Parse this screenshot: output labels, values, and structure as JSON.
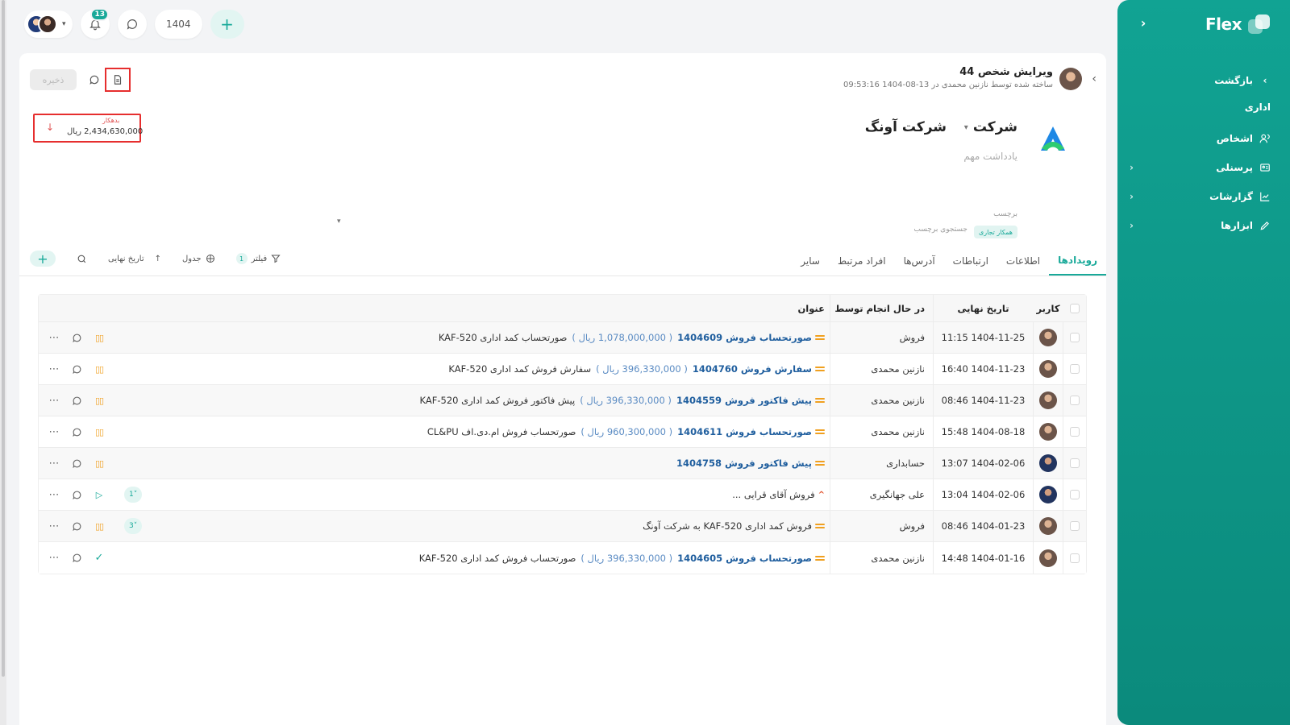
{
  "topbar": {
    "notification_count": "13",
    "year": "1404",
    "plus": "+"
  },
  "sidebar": {
    "logo": "Flex",
    "collapse": "‹",
    "back": "بازگشت",
    "section": "اداری",
    "items": [
      {
        "label": "اشخاص"
      },
      {
        "label": "پرسنلی"
      },
      {
        "label": "گزارشات"
      },
      {
        "label": "ابزارها"
      }
    ]
  },
  "header": {
    "title": "ویرایش شخص 44",
    "subtitle": "ساخته شده توسط نازنین محمدی در 13-08-1404 09:53:16",
    "save": "ذخیره"
  },
  "debt": {
    "label": "بدهکار",
    "amount": "2,434,630,000 ریال"
  },
  "company": {
    "type": "شرکت",
    "name": "شرکت آونگ",
    "note_placeholder": "یادداشت مهم"
  },
  "tags": {
    "label": "برچسب",
    "chip": "همکار تجاری",
    "search_placeholder": "جستجوی برچسب"
  },
  "tabs": [
    {
      "label": "رویدادها"
    },
    {
      "label": "اطلاعات"
    },
    {
      "label": "ارتباطات"
    },
    {
      "label": "آدرس‌ها"
    },
    {
      "label": "افراد مرتبط"
    },
    {
      "label": "سایر"
    }
  ],
  "toolbar": {
    "filter": "فیلتر",
    "filter_count": "1",
    "view": "جدول",
    "sort": "تاریخ نهایی"
  },
  "table": {
    "headers": {
      "user": "کاربر",
      "date": "تاریخ نهایی",
      "by": "در حال انجام توسط",
      "title": "عنوان"
    },
    "rows": [
      {
        "date": "1404-11-25 11:15",
        "by": "فروش",
        "doc": "صورتحساب فروش 1404609",
        "amount": "( 1,078,000,000 ریال )",
        "desc": "صورتحساب کمد اداری KAF-520"
      },
      {
        "date": "1404-11-23 16:40",
        "by": "نازنین محمدی",
        "doc": "سفارش فروش 1404760",
        "amount": "( 396,330,000 ریال )",
        "desc": "سفارش فروش کمد اداری KAF-520"
      },
      {
        "date": "1404-11-23 08:46",
        "by": "نازنین محمدی",
        "doc": "پیش فاکتور فروش 1404559",
        "amount": "( 396,330,000 ریال )",
        "desc": "پیش فاکتور فروش کمد اداری KAF-520"
      },
      {
        "date": "1404-08-18 15:48",
        "by": "نازنین محمدی",
        "doc": "صورتحساب فروش 1404611",
        "amount": "( 960,300,000 ریال )",
        "desc": "صورتحساب فروش ام.دی.اف CL&PU"
      },
      {
        "date": "1404-02-06 13:07",
        "by": "حسابداری",
        "doc": "پیش فاکتور فروش 1404758",
        "amount": "",
        "desc": ""
      },
      {
        "date": "1404-02-06 13:04",
        "by": "علی جهانگیری",
        "doc": "",
        "amount": "",
        "desc": "فروش آقای قرایی ...",
        "count": "1"
      },
      {
        "date": "1404-01-23 08:46",
        "by": "فروش",
        "doc": "",
        "amount": "",
        "desc": "فروش کمد اداری KAF-520 به شرکت آونگ",
        "count": "3"
      },
      {
        "date": "1404-01-16 14:48",
        "by": "نازنین محمدی",
        "doc": "صورتحساب فروش 1404605",
        "amount": "( 396,330,000 ریال )",
        "desc": "صورتحساب فروش کمد اداری KAF-520"
      }
    ]
  }
}
